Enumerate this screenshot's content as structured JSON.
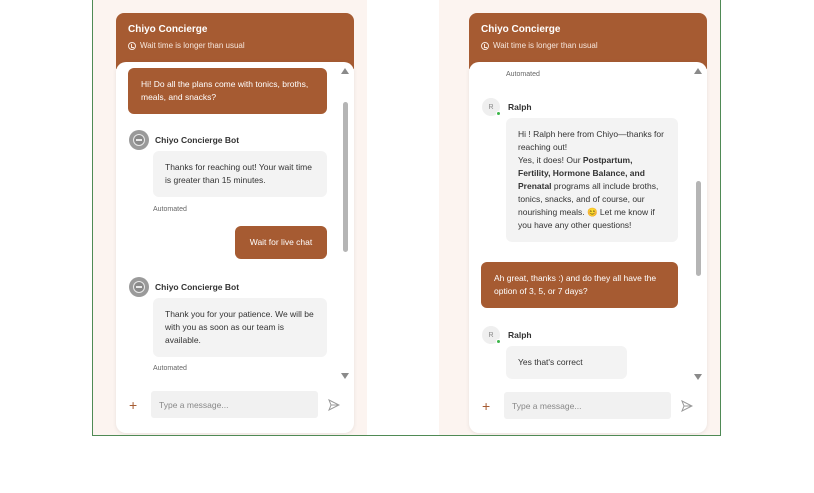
{
  "left_widget": {
    "title": "Chiyo Concierge",
    "wait_text": "Wait time is longer than usual",
    "messages": [
      {
        "type": "user",
        "text": "Hi! Do all the plans come with tonics, broths, meals, and snacks?"
      },
      {
        "type": "bot",
        "sender": "Chiyo Concierge Bot",
        "text": "Thanks for reaching out! Your wait time is greater than 15 minutes.",
        "tag": "Automated"
      },
      {
        "type": "user",
        "text": "Wait for live chat"
      },
      {
        "type": "bot",
        "sender": "Chiyo Concierge Bot",
        "text": "Thank you for your patience. We will be with you as soon as our team is available.",
        "tag": "Automated"
      }
    ],
    "input_placeholder": "Type a message...",
    "plus_label": "+"
  },
  "right_widget": {
    "title": "Chiyo Concierge",
    "wait_text": "Wait time is longer than usual",
    "top_tag": "Automated",
    "agent_name": "Ralph",
    "agent_initial": "R",
    "agent_message": {
      "line1": "Hi        ! Ralph here from Chiyo—thanks for reaching out!",
      "line2_pre": "Yes, it does! Our ",
      "line2_bold": "Postpartum, Fertility, Hormone Balance, and Prenatal",
      "line2_post": " programs all include broths, tonics, snacks, and of course, our nourishing meals. 😊 Let me know if you have any other questions!"
    },
    "user_message": "Ah great, thanks :) and do they all have the option of 3, 5, or 7 days?",
    "agent_reply": "Yes that's correct",
    "input_placeholder": "Type a message...",
    "plus_label": "+"
  },
  "colors": {
    "brand": "#a65b32",
    "bubble": "#f3f3f3",
    "online": "#3cb54a"
  }
}
